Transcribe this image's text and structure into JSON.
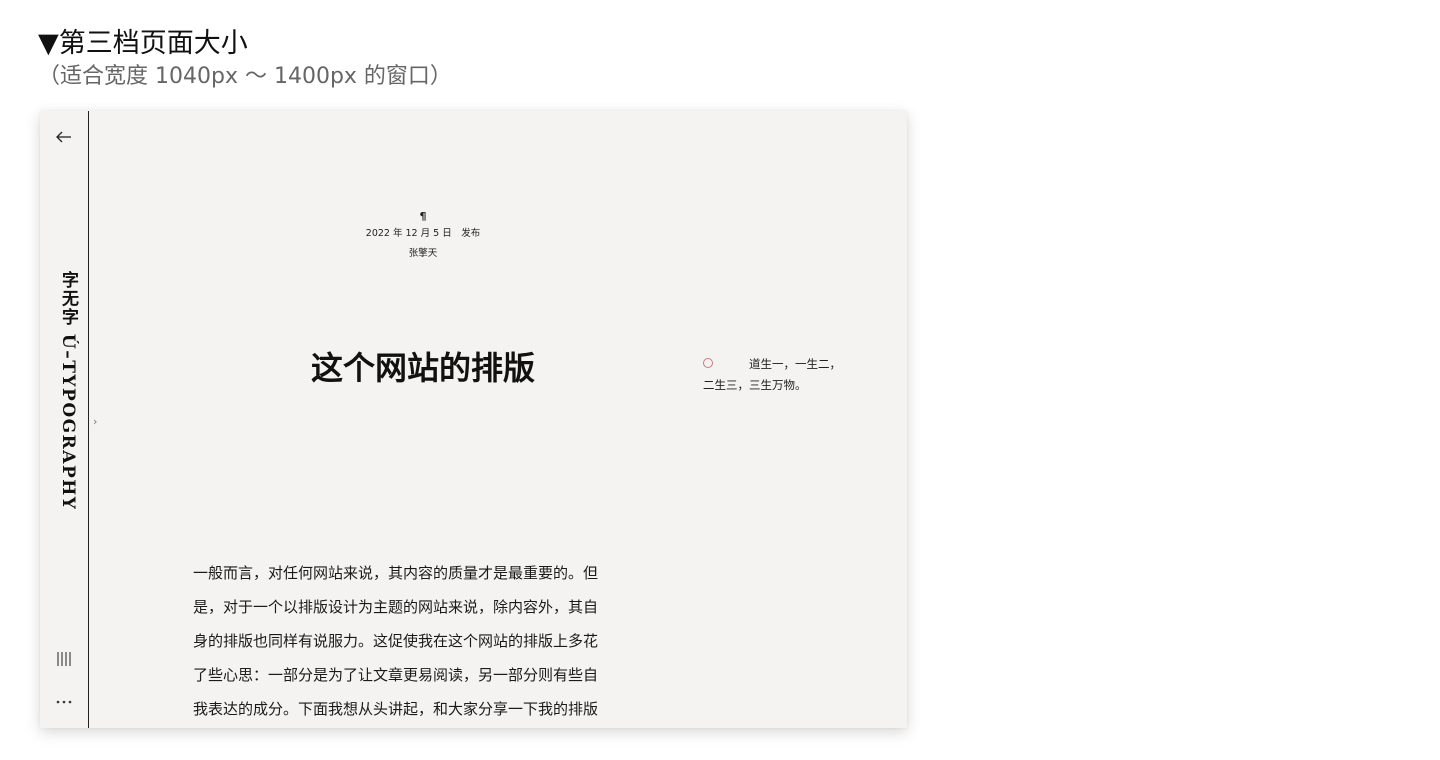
{
  "heading": {
    "title": "▼第三档页面大小",
    "subtitle": "（适合宽度 1040px ～ 1400px 的窗口）"
  },
  "sidebar": {
    "brand": "字无字 Ú–TYPOGRAPHY",
    "icons": [
      "back-arrow-icon",
      "bars-icon",
      "more-dots-icon"
    ]
  },
  "toggle": {
    "label": "›"
  },
  "article": {
    "pilcrow": "¶",
    "date_line": "2022 年 12 月 5 日　发布",
    "author": "张擎天",
    "title": "这个网站的排版",
    "sidenote_line1": "道生一，一生二，",
    "sidenote_line2": "二生三，三生万物。",
    "body_lines": [
      "一般而言，对任何网站来说，其内容的质量才是最重要的。但",
      "是，对于一个以排版设计为主题的网站来说，除内容外，其自",
      "身的排版也同样有说服力。这促使我在这个网站的排版上多花",
      "了些心思：一部分是为了让文章更易阅读，另一部分则有些自",
      "我表达的成分。下面我想从头讲起，和大家分享一下我的排版"
    ]
  },
  "colors": {
    "page_background": "#f4f3f1",
    "sidenote_marker": "#c87a82",
    "text": "#111111"
  }
}
